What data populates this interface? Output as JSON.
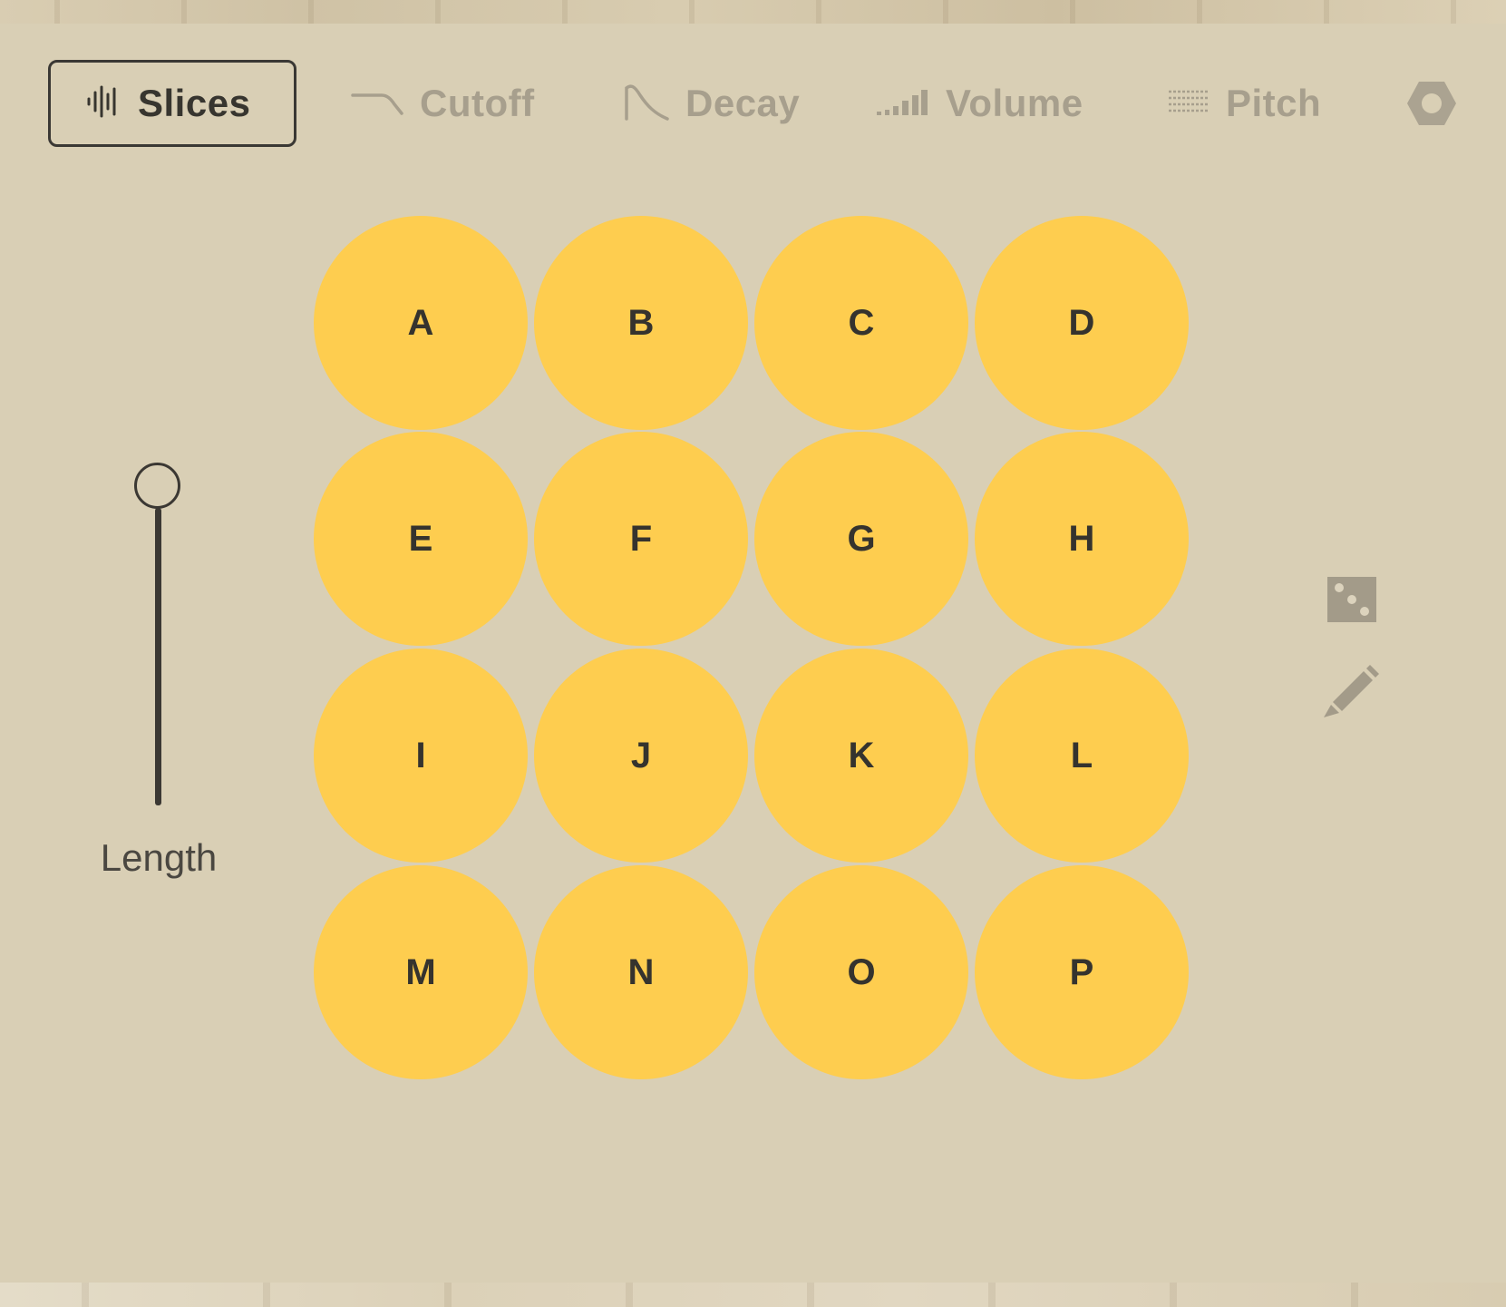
{
  "tabs": [
    {
      "label": "Slices",
      "icon": "waveform-icon",
      "active": true
    },
    {
      "label": "Cutoff",
      "icon": "cutoff-curve-icon",
      "active": false
    },
    {
      "label": "Decay",
      "icon": "decay-curve-icon",
      "active": false
    },
    {
      "label": "Volume",
      "icon": "volume-bars-icon",
      "active": false
    },
    {
      "label": "Pitch",
      "icon": "pitch-lines-icon",
      "active": false
    }
  ],
  "settings_icon": "hexagon-icon",
  "slider": {
    "label": "Length",
    "value": 1.0
  },
  "pads": [
    "A",
    "B",
    "C",
    "D",
    "E",
    "F",
    "G",
    "H",
    "I",
    "J",
    "K",
    "L",
    "M",
    "N",
    "O",
    "P"
  ],
  "tools": {
    "randomize_icon": "dice-icon",
    "edit_icon": "pencil-icon"
  },
  "colors": {
    "background": "#d9cfb5",
    "pad": "#fecd4f",
    "pad_text": "#35332e",
    "active_tab_text": "#37352f",
    "inactive_tab_text": "#a79f8d"
  }
}
